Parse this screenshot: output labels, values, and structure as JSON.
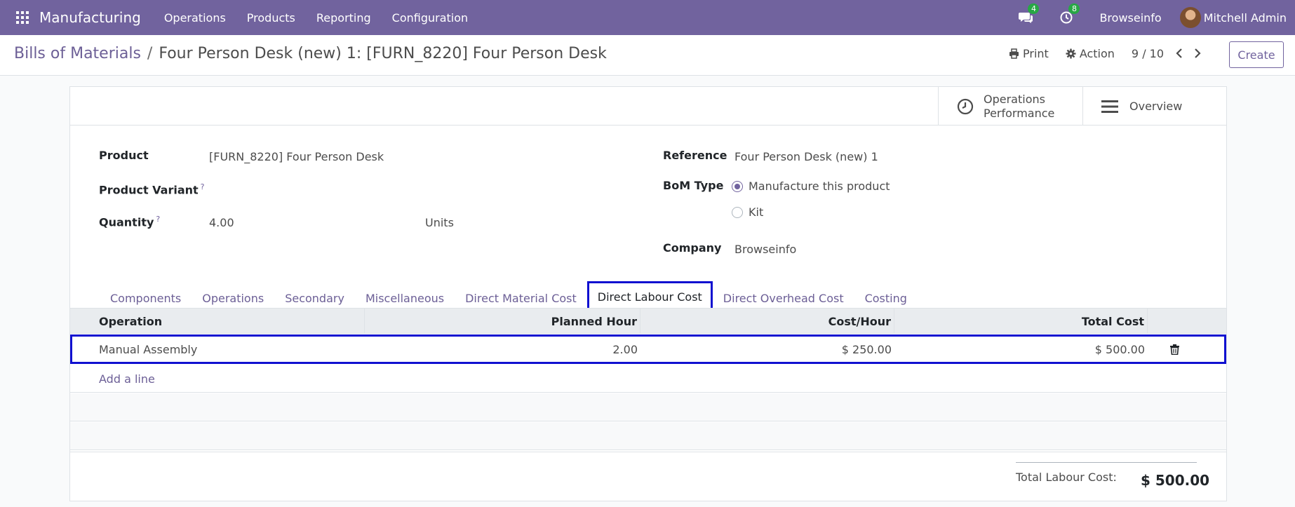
{
  "navbar": {
    "app_name": "Manufacturing",
    "menu": [
      "Operations",
      "Products",
      "Reporting",
      "Configuration"
    ],
    "messages_count": "4",
    "activities_count": "8",
    "company": "Browseinfo",
    "user": "Mitchell Admin",
    "color": "#71639e"
  },
  "control_panel": {
    "breadcrumb_parent": "Bills of Materials",
    "breadcrumb_separator": "/",
    "breadcrumb_current": "Four Person Desk (new) 1: [FURN_8220] Four Person Desk",
    "print_label": "Print",
    "action_label": "Action",
    "pager": "9 / 10",
    "create_label": "Create"
  },
  "stat_buttons": {
    "operations_performance_line1": "Operations",
    "operations_performance_line2": "Performance",
    "overview": "Overview"
  },
  "form": {
    "product_label": "Product",
    "product_value": "[FURN_8220] Four Person Desk",
    "variant_label": "Product Variant",
    "help_mark": "?",
    "quantity_label": "Quantity",
    "quantity_value": "4.00",
    "uom_value": "Units",
    "reference_label": "Reference",
    "reference_value": "Four Person Desk (new) 1",
    "bom_type_label": "BoM Type",
    "bom_type_options": [
      "Manufacture this product",
      "Kit"
    ],
    "bom_type_selected": "Manufacture this product",
    "company_label": "Company",
    "company_value": "Browseinfo"
  },
  "tabs": [
    "Components",
    "Operations",
    "Secondary",
    "Miscellaneous",
    "Direct Material Cost",
    "Direct Labour Cost",
    "Direct Overhead Cost",
    "Costing"
  ],
  "active_tab": "Direct Labour Cost",
  "table": {
    "headers": [
      "Operation",
      "Planned Hour",
      "Cost/Hour",
      "Total Cost"
    ],
    "rows": [
      {
        "operation": "Manual Assembly",
        "planned_hour": "2.00",
        "cost_hour": "$ 250.00",
        "total_cost": "$ 500.00"
      }
    ],
    "add_line": "Add a line"
  },
  "totals": {
    "label": "Total Labour Cost:",
    "value": "$ 500.00"
  },
  "highlight_color": "#1010d0"
}
